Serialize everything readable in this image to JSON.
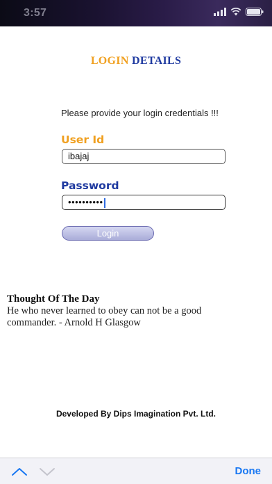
{
  "status_bar": {
    "time": "3:57"
  },
  "heading": {
    "word1": "LOGIN",
    "word2": "DETAILS",
    "color1": "#f0a020",
    "color2": "#1f3aa0"
  },
  "form": {
    "instructions": "Please provide your login credentials !!!",
    "user_label": "User Id",
    "user_value": "ibajaj",
    "password_label": "Password",
    "password_value": "••••••••••",
    "login_label": "Login"
  },
  "thought": {
    "title": "Thought Of The Day",
    "text": "He who never learned to obey can not be a good commander. - Arnold H Glasgow"
  },
  "footer": {
    "credit": "Developed By Dips Imagination Pvt. Ltd."
  },
  "keyboard_bar": {
    "prev_icon": "chevron-up-icon",
    "next_icon": "chevron-down-icon",
    "done_label": "Done",
    "accent": "#1877f2"
  }
}
